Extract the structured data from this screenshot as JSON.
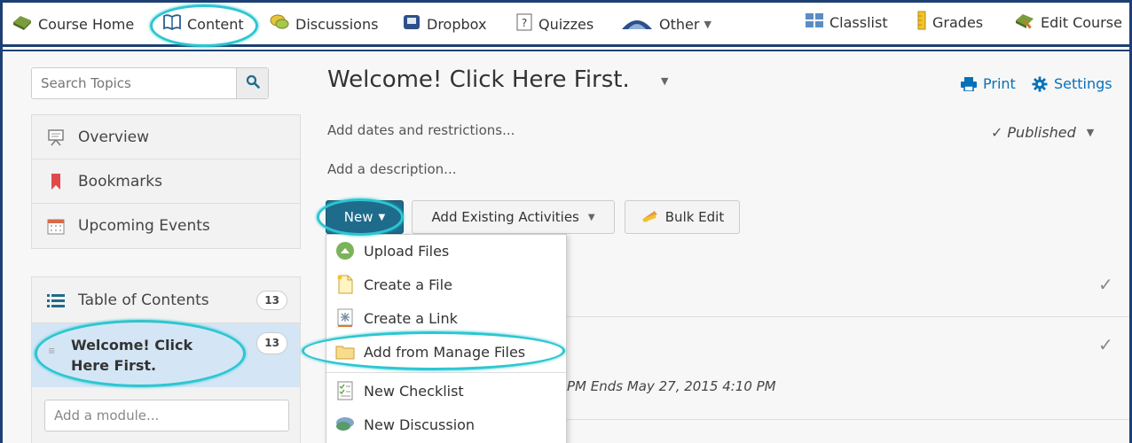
{
  "nav": {
    "items": [
      {
        "label": "Course Home",
        "icon": "course-home-icon"
      },
      {
        "label": "Content",
        "icon": "book-icon"
      },
      {
        "label": "Discussions",
        "icon": "discussions-icon"
      },
      {
        "label": "Dropbox",
        "icon": "dropbox-icon"
      },
      {
        "label": "Quizzes",
        "icon": "quizzes-icon"
      },
      {
        "label": "Other",
        "icon": "other-icon"
      },
      {
        "label": "Classlist",
        "icon": "classlist-icon"
      },
      {
        "label": "Grades",
        "icon": "grades-icon"
      },
      {
        "label": "Edit Course",
        "icon": "edit-course-icon"
      }
    ]
  },
  "sidebar": {
    "search_placeholder": "Search Topics",
    "items": [
      {
        "label": "Overview",
        "icon": "overview-icon"
      },
      {
        "label": "Bookmarks",
        "icon": "bookmark-icon"
      },
      {
        "label": "Upcoming Events",
        "icon": "calendar-icon"
      }
    ],
    "toc_label": "Table of Contents",
    "toc_count": "13",
    "active_module_line1": "Welcome! Click",
    "active_module_line2": "Here First.",
    "active_module_count": "13",
    "add_module_placeholder": "Add a module..."
  },
  "main": {
    "title": "Welcome! Click Here First.",
    "print_label": "Print",
    "settings_label": "Settings",
    "dates_link": "Add dates and restrictions...",
    "description_link": "Add a description...",
    "published_label": "Published",
    "new_button": "New",
    "add_existing_button": "Add Existing Activities",
    "bulk_edit_button": "Bulk Edit",
    "dates_text_partial": "PM  Ends May 27, 2015 4:10 PM"
  },
  "dropdown": {
    "items": [
      {
        "label": "Upload Files",
        "icon": "upload-icon"
      },
      {
        "label": "Create a File",
        "icon": "new-file-icon"
      },
      {
        "label": "Create a Link",
        "icon": "link-icon"
      },
      {
        "label": "Add from Manage Files",
        "icon": "folder-icon"
      },
      {
        "label": "New Checklist",
        "icon": "checklist-icon"
      },
      {
        "label": "New Discussion",
        "icon": "discussion-icon"
      }
    ]
  },
  "colors": {
    "nav_border": "#1d3f73",
    "highlight": "#2cc6d1",
    "link_blue": "#0870b8",
    "new_button_bg": "#1f6b8c",
    "active_module_bg": "#d4e6f5"
  }
}
